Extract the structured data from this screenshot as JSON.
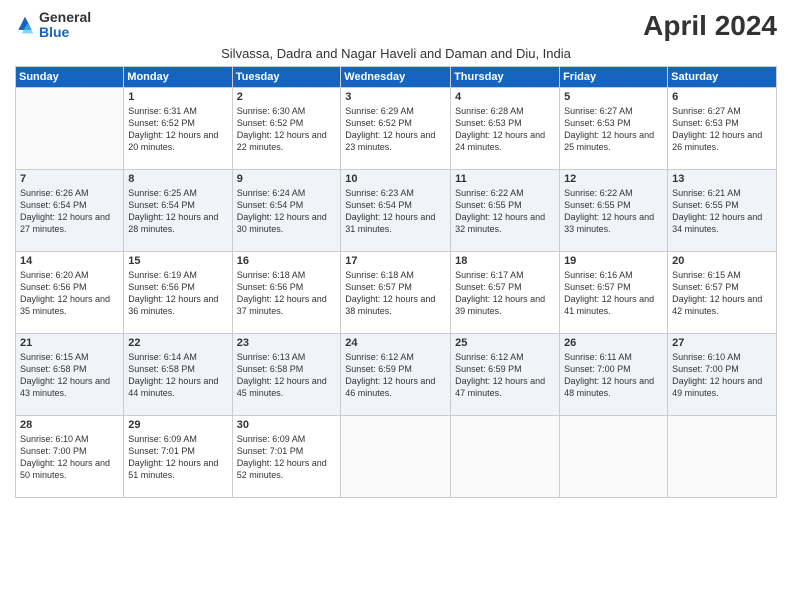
{
  "header": {
    "logo": {
      "line1": "General",
      "line2": "Blue"
    },
    "title": "April 2024",
    "subtitle": "Silvassa, Dadra and Nagar Haveli and Daman and Diu, India"
  },
  "days_of_week": [
    "Sunday",
    "Monday",
    "Tuesday",
    "Wednesday",
    "Thursday",
    "Friday",
    "Saturday"
  ],
  "weeks": [
    {
      "alt": false,
      "days": [
        {
          "num": "",
          "info": ""
        },
        {
          "num": "1",
          "info": "Sunrise: 6:31 AM\nSunset: 6:52 PM\nDaylight: 12 hours\nand 20 minutes."
        },
        {
          "num": "2",
          "info": "Sunrise: 6:30 AM\nSunset: 6:52 PM\nDaylight: 12 hours\nand 22 minutes."
        },
        {
          "num": "3",
          "info": "Sunrise: 6:29 AM\nSunset: 6:52 PM\nDaylight: 12 hours\nand 23 minutes."
        },
        {
          "num": "4",
          "info": "Sunrise: 6:28 AM\nSunset: 6:53 PM\nDaylight: 12 hours\nand 24 minutes."
        },
        {
          "num": "5",
          "info": "Sunrise: 6:27 AM\nSunset: 6:53 PM\nDaylight: 12 hours\nand 25 minutes."
        },
        {
          "num": "6",
          "info": "Sunrise: 6:27 AM\nSunset: 6:53 PM\nDaylight: 12 hours\nand 26 minutes."
        }
      ]
    },
    {
      "alt": true,
      "days": [
        {
          "num": "7",
          "info": "Sunrise: 6:26 AM\nSunset: 6:54 PM\nDaylight: 12 hours\nand 27 minutes."
        },
        {
          "num": "8",
          "info": "Sunrise: 6:25 AM\nSunset: 6:54 PM\nDaylight: 12 hours\nand 28 minutes."
        },
        {
          "num": "9",
          "info": "Sunrise: 6:24 AM\nSunset: 6:54 PM\nDaylight: 12 hours\nand 30 minutes."
        },
        {
          "num": "10",
          "info": "Sunrise: 6:23 AM\nSunset: 6:54 PM\nDaylight: 12 hours\nand 31 minutes."
        },
        {
          "num": "11",
          "info": "Sunrise: 6:22 AM\nSunset: 6:55 PM\nDaylight: 12 hours\nand 32 minutes."
        },
        {
          "num": "12",
          "info": "Sunrise: 6:22 AM\nSunset: 6:55 PM\nDaylight: 12 hours\nand 33 minutes."
        },
        {
          "num": "13",
          "info": "Sunrise: 6:21 AM\nSunset: 6:55 PM\nDaylight: 12 hours\nand 34 minutes."
        }
      ]
    },
    {
      "alt": false,
      "days": [
        {
          "num": "14",
          "info": "Sunrise: 6:20 AM\nSunset: 6:56 PM\nDaylight: 12 hours\nand 35 minutes."
        },
        {
          "num": "15",
          "info": "Sunrise: 6:19 AM\nSunset: 6:56 PM\nDaylight: 12 hours\nand 36 minutes."
        },
        {
          "num": "16",
          "info": "Sunrise: 6:18 AM\nSunset: 6:56 PM\nDaylight: 12 hours\nand 37 minutes."
        },
        {
          "num": "17",
          "info": "Sunrise: 6:18 AM\nSunset: 6:57 PM\nDaylight: 12 hours\nand 38 minutes."
        },
        {
          "num": "18",
          "info": "Sunrise: 6:17 AM\nSunset: 6:57 PM\nDaylight: 12 hours\nand 39 minutes."
        },
        {
          "num": "19",
          "info": "Sunrise: 6:16 AM\nSunset: 6:57 PM\nDaylight: 12 hours\nand 41 minutes."
        },
        {
          "num": "20",
          "info": "Sunrise: 6:15 AM\nSunset: 6:57 PM\nDaylight: 12 hours\nand 42 minutes."
        }
      ]
    },
    {
      "alt": true,
      "days": [
        {
          "num": "21",
          "info": "Sunrise: 6:15 AM\nSunset: 6:58 PM\nDaylight: 12 hours\nand 43 minutes."
        },
        {
          "num": "22",
          "info": "Sunrise: 6:14 AM\nSunset: 6:58 PM\nDaylight: 12 hours\nand 44 minutes."
        },
        {
          "num": "23",
          "info": "Sunrise: 6:13 AM\nSunset: 6:58 PM\nDaylight: 12 hours\nand 45 minutes."
        },
        {
          "num": "24",
          "info": "Sunrise: 6:12 AM\nSunset: 6:59 PM\nDaylight: 12 hours\nand 46 minutes."
        },
        {
          "num": "25",
          "info": "Sunrise: 6:12 AM\nSunset: 6:59 PM\nDaylight: 12 hours\nand 47 minutes."
        },
        {
          "num": "26",
          "info": "Sunrise: 6:11 AM\nSunset: 7:00 PM\nDaylight: 12 hours\nand 48 minutes."
        },
        {
          "num": "27",
          "info": "Sunrise: 6:10 AM\nSunset: 7:00 PM\nDaylight: 12 hours\nand 49 minutes."
        }
      ]
    },
    {
      "alt": false,
      "days": [
        {
          "num": "28",
          "info": "Sunrise: 6:10 AM\nSunset: 7:00 PM\nDaylight: 12 hours\nand 50 minutes."
        },
        {
          "num": "29",
          "info": "Sunrise: 6:09 AM\nSunset: 7:01 PM\nDaylight: 12 hours\nand 51 minutes."
        },
        {
          "num": "30",
          "info": "Sunrise: 6:09 AM\nSunset: 7:01 PM\nDaylight: 12 hours\nand 52 minutes."
        },
        {
          "num": "",
          "info": ""
        },
        {
          "num": "",
          "info": ""
        },
        {
          "num": "",
          "info": ""
        },
        {
          "num": "",
          "info": ""
        }
      ]
    }
  ]
}
